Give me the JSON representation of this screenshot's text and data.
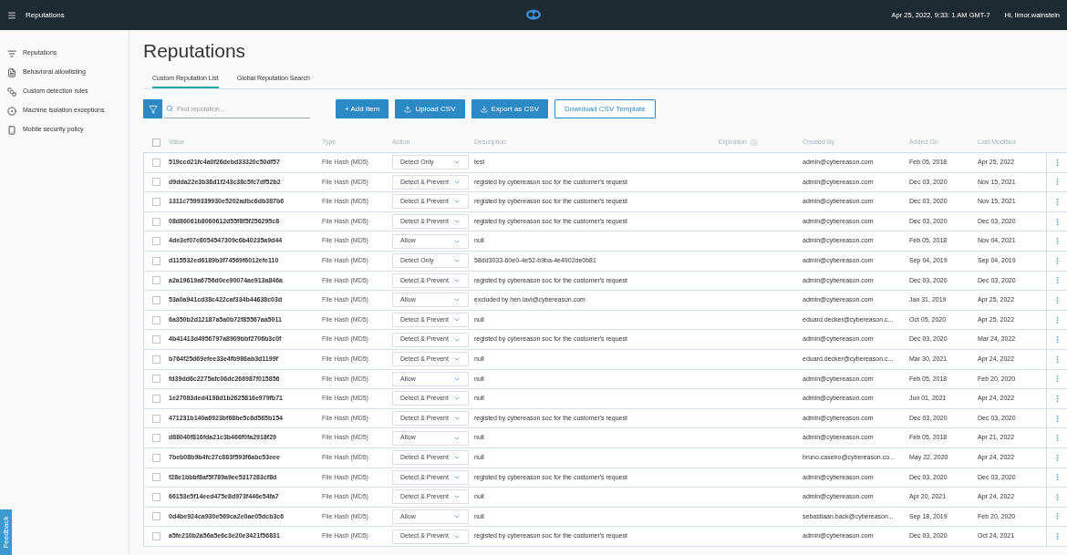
{
  "top_bar": {
    "title": "Reputations",
    "datetime": "Apr 25, 2022, 9:33: 1 AM GMT-7",
    "user": "Hi, limor.wainstein"
  },
  "sidebar": {
    "items": [
      {
        "label": "Reputations",
        "kind": "list"
      },
      {
        "label": "Behavioral allowlisting",
        "kind": "doc"
      },
      {
        "label": "Custom detection rules",
        "kind": "rules"
      },
      {
        "label": "Machine isolation exceptions",
        "kind": "circle"
      },
      {
        "label": "Mobile security policy",
        "kind": "phone"
      }
    ]
  },
  "page": {
    "title": "Reputations"
  },
  "tabs": [
    {
      "label": "Custom Reputation List",
      "selected": true
    },
    {
      "label": "Global Reputation Search",
      "selected": false
    }
  ],
  "toolbar": {
    "search": {
      "placeholder": "Find reputation..."
    },
    "buttons": [
      {
        "label": "+ Add Item",
        "kind": "filled"
      },
      {
        "label": "Upload CSV",
        "kind": "filled_icon"
      },
      {
        "label": "Export as CSV",
        "kind": "filled_icon"
      },
      {
        "label": "Download CSV Template",
        "kind": "outline"
      }
    ]
  },
  "table": {
    "columns": [
      "Value",
      "Type",
      "Action",
      "Description",
      "Expiration",
      "Created By",
      "Added On",
      "Last Modified"
    ],
    "select_all_checked": false,
    "rows": [
      {
        "value": "519ccd21fc4a0f26debd33320c50df57",
        "type": "File Hash (MD5)",
        "action": "Detect Only",
        "description": "test",
        "created_by": "admin@cybereason.com",
        "added_on": "Feb 05, 2018",
        "last_modified": "Apr 25, 2022",
        "checked": false
      },
      {
        "value": "d9dda22e3b38d1f243c38c5fc7df52b2",
        "type": "File Hash (MD5)",
        "action": "Detect & Prevent",
        "description": "registed by cybereason soc for the customer's request",
        "created_by": "admin@cybereason.com",
        "added_on": "Dec 03, 2020",
        "last_modified": "Nov 15, 2021",
        "checked": false
      },
      {
        "value": "1311c7599339930e5202adbc6db387b6",
        "type": "File Hash (MD5)",
        "action": "Detect & Prevent",
        "description": "registed by cybereason soc for the customer's request",
        "created_by": "admin@cybereason.com",
        "added_on": "Dec 03, 2020",
        "last_modified": "Nov 15, 2021",
        "checked": false
      },
      {
        "value": "08d86061b8060612d55f8f5f256295c8",
        "type": "File Hash (MD5)",
        "action": "Detect & Prevent",
        "description": "registed by cybereason soc for the customer's request",
        "created_by": "admin@cybereason.com",
        "added_on": "Dec 03, 2020",
        "last_modified": "Dec 03, 2020",
        "checked": false
      },
      {
        "value": "4de3ef07e8054547309c6b40235a9d44",
        "type": "File Hash (MD5)",
        "action": "Allow",
        "description": "null",
        "created_by": "admin@cybereason.com",
        "added_on": "Feb 05, 2018",
        "last_modified": "Nov 04, 2021",
        "checked": false
      },
      {
        "value": "d115532ed6189b3f74569f6012efe110",
        "type": "File Hash (MD5)",
        "action": "Detect Only",
        "description": "58dd3033-60e0-4e52-b9ba-4e4902de0b81",
        "created_by": "admin@cybereason.com",
        "added_on": "Sep 04, 2019",
        "last_modified": "Sep 04, 2019",
        "checked": false
      },
      {
        "value": "a2a19619a6756d0ee90074ae913a846a",
        "type": "File Hash (MD5)",
        "action": "Detect & Prevent",
        "description": "registed by cybereason soc for the customer's request",
        "created_by": "admin@cybereason.com",
        "added_on": "Dec 03, 2020",
        "last_modified": "Dec 03, 2020",
        "checked": false
      },
      {
        "value": "53a0a941cd38c422caf334b44638c03d",
        "type": "File Hash (MD5)",
        "action": "Allow",
        "description": "excluded by hen.lavi@cybereason.com",
        "created_by": "admin@cybereason.com",
        "added_on": "Jan 31, 2019",
        "last_modified": "Apr 25, 2022",
        "checked": false
      },
      {
        "value": "6a350b2d12187a5a0b72f85567aa5011",
        "type": "File Hash (MD5)",
        "action": "Detect & Prevent",
        "description": "null",
        "created_by": "eduard.decker@cybereason.c...",
        "added_on": "Oct 05, 2020",
        "last_modified": "Apr 25, 2022",
        "checked": false
      },
      {
        "value": "4b41413d4956797a8909bbf2706b3c0f",
        "type": "File Hash (MD5)",
        "action": "Detect & Prevent",
        "description": "registed by cybereason soc for the customer's request",
        "created_by": "admin@cybereason.com",
        "added_on": "Dec 03, 2020",
        "last_modified": "Mar 24, 2022",
        "checked": false
      },
      {
        "value": "b764f25d69efee33e4fb986ab3d1199f",
        "type": "File Hash (MD5)",
        "action": "Detect & Prevent",
        "description": "null",
        "created_by": "eduard.decker@cybereason.c...",
        "added_on": "Mar 30, 2021",
        "last_modified": "Apr 24, 2022",
        "checked": false
      },
      {
        "value": "fd39dd6c2275afc06dc266987f015856",
        "type": "File Hash (MD5)",
        "action": "Allow",
        "description": "null",
        "created_by": "admin@cybereason.com",
        "added_on": "Feb 05, 2018",
        "last_modified": "Feb 20, 2020",
        "checked": false
      },
      {
        "value": "1e27083ded4198d1b2625816e979fb71",
        "type": "File Hash (MD5)",
        "action": "Detect & Prevent",
        "description": "null",
        "created_by": "admin@cybereason.com",
        "added_on": "Jun 01, 2021",
        "last_modified": "Apr 24, 2022",
        "checked": false
      },
      {
        "value": "471231b140a6923bf68be5c6d565b154",
        "type": "File Hash (MD5)",
        "action": "Detect & Prevent",
        "description": "registed by cybereason soc for the customer's request",
        "created_by": "admin@cybereason.com",
        "added_on": "Dec 03, 2020",
        "last_modified": "Dec 03, 2020",
        "checked": false
      },
      {
        "value": "d88040f816fda21c3b466f0fa2918f29",
        "type": "File Hash (MD5)",
        "action": "Allow",
        "description": "null",
        "created_by": "admin@cybereason.com",
        "added_on": "Feb 05, 2018",
        "last_modified": "Apr 21, 2022",
        "checked": false
      },
      {
        "value": "7beb08b9b4fc27c883f593f6abc53eee",
        "type": "File Hash (MD5)",
        "action": "Detect & Prevent",
        "description": "null",
        "created_by": "bruno.caseiro@cybereason.co...",
        "added_on": "May 22, 2020",
        "last_modified": "Apr 24, 2022",
        "checked": false
      },
      {
        "value": "f28e1bbbf8af5f789a9ee5317283cf8d",
        "type": "File Hash (MD5)",
        "action": "Detect & Prevent",
        "description": "registed by cybereason soc for the customer's request",
        "created_by": "admin@cybereason.com",
        "added_on": "Dec 03, 2020",
        "last_modified": "Dec 03, 2020",
        "checked": false
      },
      {
        "value": "66153e5f14eed475e8d973f446e54fa7",
        "type": "File Hash (MD5)",
        "action": "Detect & Prevent",
        "description": "null",
        "created_by": "admin@cybereason.com",
        "added_on": "Apr 20, 2021",
        "last_modified": "Apr 24, 2022",
        "checked": false
      },
      {
        "value": "0d4be924ca930e569ca2e0ae05dcb3c6",
        "type": "File Hash (MD5)",
        "action": "Allow",
        "description": "null",
        "created_by": "sebastiaan.back@cybereason...",
        "added_on": "Sep 18, 2019",
        "last_modified": "Feb 20, 2020",
        "checked": false
      },
      {
        "value": "a5fe210b2a56a5e6c3e20e3421f56831",
        "type": "File Hash (MD5)",
        "action": "Detect & Prevent",
        "description": "registed by cybereason soc for the customer's request",
        "created_by": "admin@cybereason.com",
        "added_on": "Dec 03, 2020",
        "last_modified": "Oct 24, 2021",
        "checked": false
      }
    ]
  },
  "feedback_tab": {
    "label": "Feedback"
  }
}
